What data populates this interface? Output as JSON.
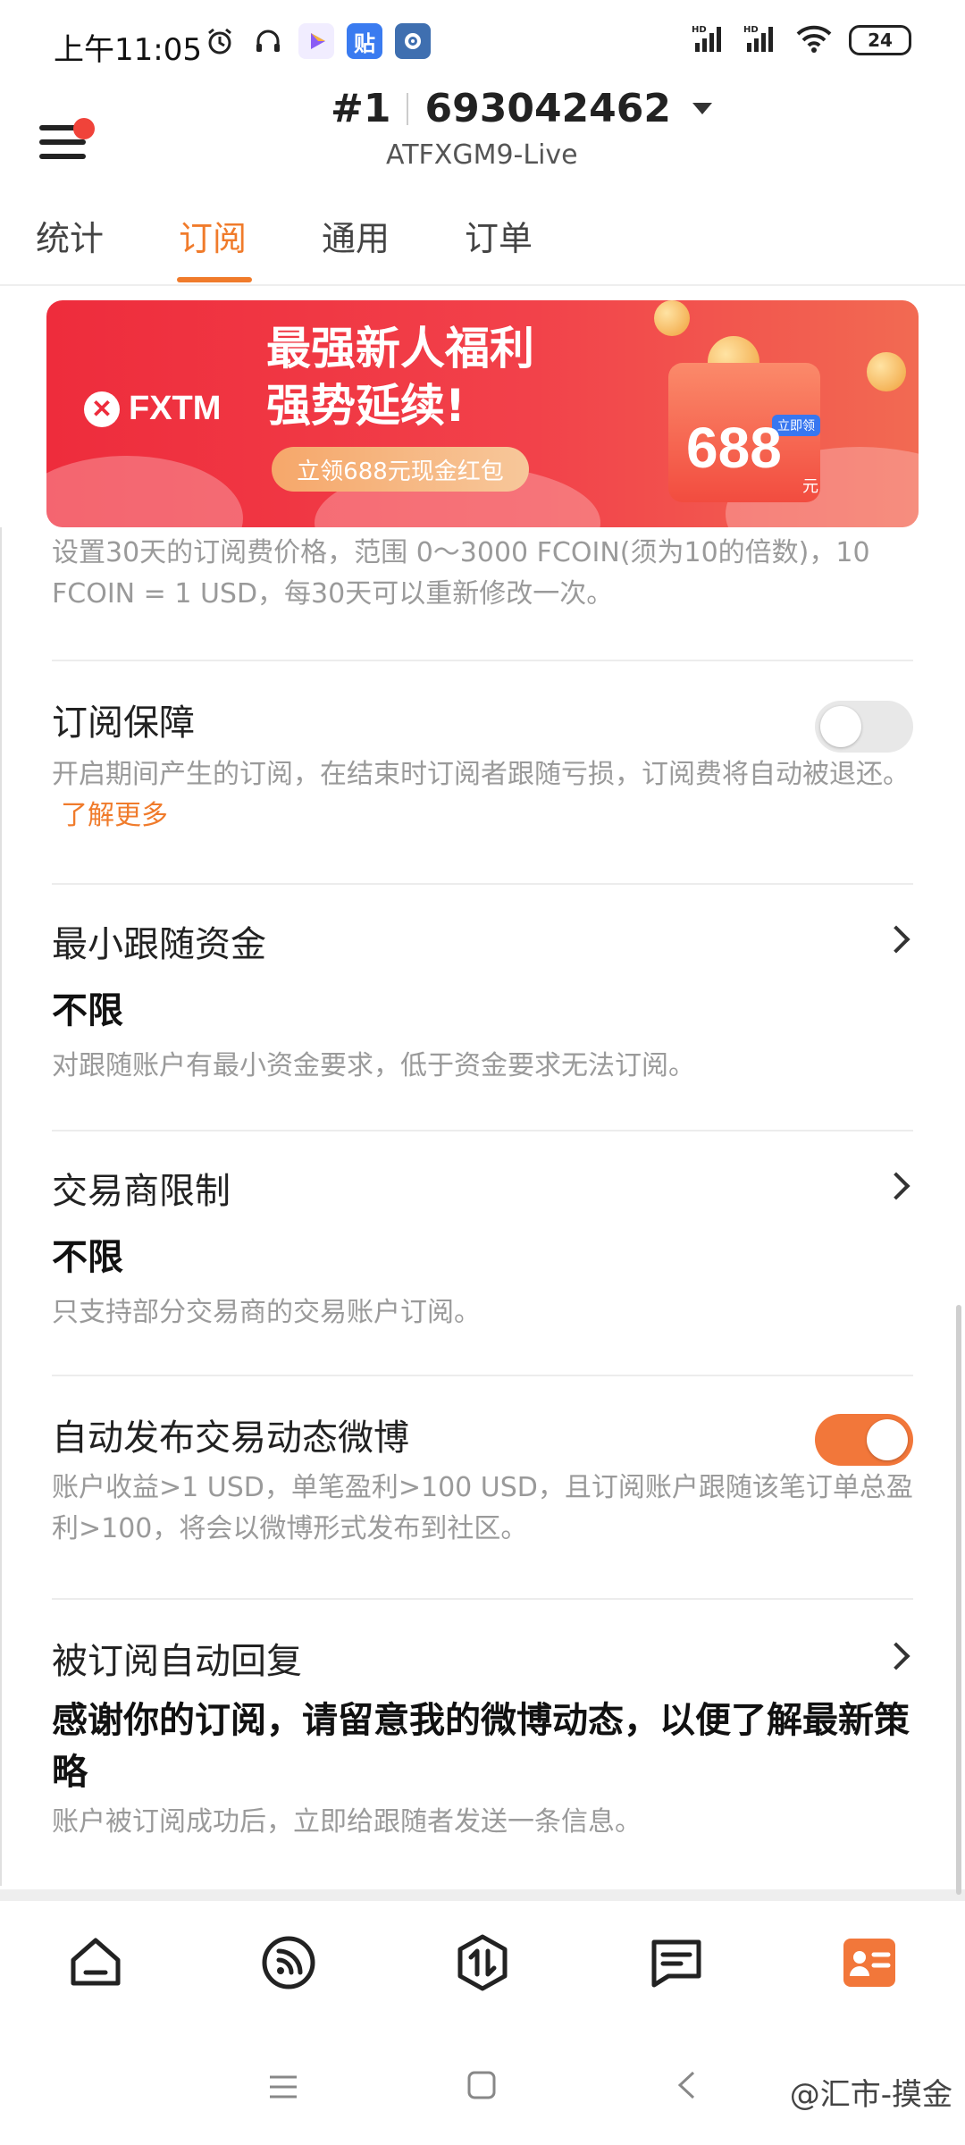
{
  "status_bar": {
    "time": "上午11:05",
    "battery": "24",
    "left_icons": [
      "alarm-icon",
      "headset-icon",
      "video-app-icon",
      "tieba-app-icon",
      "settings-app-icon"
    ],
    "tieba_label": "贴",
    "right_icons": [
      "signal-hd-1-icon",
      "signal-hd-2-icon",
      "wifi-icon",
      "battery-icon"
    ]
  },
  "header": {
    "rank": "#1",
    "account_number": "693042462",
    "server": "ATFXGM9-Live"
  },
  "tabs": [
    {
      "label": "统计",
      "active": false
    },
    {
      "label": "订阅",
      "active": true
    },
    {
      "label": "通用",
      "active": false
    },
    {
      "label": "订单",
      "active": false
    }
  ],
  "banner": {
    "brand": "FXTM",
    "headline_1": "最强新人福利",
    "headline_2": "强势延续!",
    "pill_text": "立领688元现金红包",
    "amount": "688",
    "amount_unit": "元",
    "tag": "立即领"
  },
  "fee_description": "设置30天的订阅费价格，范围 0～3000 FCOIN(须为10的倍数)，10 FCOIN = 1 USD，每30天可以重新修改一次。",
  "sections": {
    "guarantee": {
      "title": "订阅保障",
      "description": "开启期间产生的订阅，在结束时订阅者跟随亏损，订阅费将自动被退还。",
      "link": "了解更多",
      "enabled": false
    },
    "min_funds": {
      "title": "最小跟随资金",
      "value": "不限",
      "description": "对跟随账户有最小资金要求，低于资金要求无法订阅。"
    },
    "broker_limit": {
      "title": "交易商限制",
      "value": "不限",
      "description": "只支持部分交易商的交易账户订阅。"
    },
    "auto_weibo": {
      "title": "自动发布交易动态微博",
      "description": "账户收益>1 USD，单笔盈利>100 USD，且订阅账户跟随该笔订单总盈利>100，将会以微博形式发布到社区。",
      "enabled": true
    },
    "auto_reply": {
      "title": "被订阅自动回复",
      "value": "感谢你的订阅，请留意我的微博动态，以便了解最新策略",
      "description": "账户被订阅成功后，立即给跟随者发送一条信息。"
    }
  },
  "bottom_nav": [
    "home-icon",
    "feed-icon",
    "trade-icon",
    "message-icon",
    "profile-card-icon"
  ],
  "system_nav": [
    "recent-apps-icon",
    "home-square-icon",
    "back-icon"
  ],
  "watermark": "@汇市-摸金",
  "colors": {
    "accent": "#f07b2b",
    "banner_red": "#ee2c3c",
    "toggle_on": "#f2773a"
  }
}
